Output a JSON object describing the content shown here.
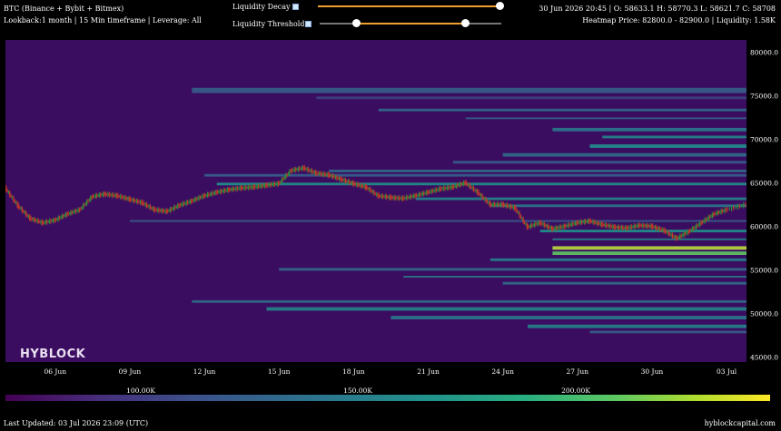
{
  "header": {
    "title": "BTC (Binance + Bybit + Bitmex)",
    "subtitle": "Lookback:1 month | 15 Min timeframe | Leverage: All",
    "ohlc": "30 Jun 2026 20:45 | O: 58633.1 H: 58770.3 L: 58621.7 C: 58708",
    "heatmap_info": "Heatmap Price: 82800.0 - 82900.0 | Liquidity: 1.58K"
  },
  "controls": {
    "decay_label": "Liquidity Decay",
    "threshold_label": "Liquidity Threshold",
    "decay_value": 1.0,
    "threshold_range": [
      0.2,
      0.8
    ]
  },
  "colors": {
    "track": "#f0a030",
    "background": "#3b0d61",
    "candle_up": "#2e8b3a",
    "candle_down": "#c0392b"
  },
  "watermark": "HYBLOCK",
  "colorbar": {
    "ticks": [
      "100.00K",
      "150.00K",
      "200.00K"
    ]
  },
  "footer": {
    "updated": "Last Updated: 03 Jul 2026 23:09 (UTC)",
    "site": "hyblockcapital.com"
  },
  "chart_data": {
    "type": "heatmap",
    "y_ticks": [
      "80000.0",
      "75000.0",
      "70000.0",
      "65000.0",
      "60000.0",
      "55000.0",
      "50000.0",
      "45000.0"
    ],
    "y_tick_values": [
      80000,
      75000,
      70000,
      65000,
      60000,
      55000,
      50000,
      45000
    ],
    "ylim": [
      44500,
      81500
    ],
    "x_ticks": [
      "06 Jun",
      "09 Jun",
      "12 Jun",
      "15 Jun",
      "18 Jun",
      "21 Jun",
      "24 Jun",
      "27 Jun",
      "30 Jun",
      "03 Jul"
    ],
    "x_tick_days": [
      6,
      9,
      12,
      15,
      18,
      21,
      24,
      27,
      30,
      33
    ],
    "xlim_days": [
      4.0,
      33.8
    ],
    "price_series": {
      "day": [
        4.0,
        4.5,
        5.0,
        5.5,
        6.0,
        6.5,
        7.0,
        7.5,
        8.0,
        8.5,
        9.0,
        9.5,
        10.0,
        10.5,
        11.0,
        11.5,
        12.0,
        12.5,
        13.0,
        13.5,
        14.0,
        14.5,
        15.0,
        15.5,
        16.0,
        16.5,
        17.0,
        17.5,
        18.0,
        18.5,
        19.0,
        19.5,
        20.0,
        20.5,
        21.0,
        21.5,
        22.0,
        22.5,
        23.0,
        23.5,
        24.0,
        24.5,
        25.0,
        25.5,
        26.0,
        26.5,
        27.0,
        27.5,
        28.0,
        28.5,
        29.0,
        29.5,
        30.0,
        30.5,
        31.0,
        31.5,
        32.0,
        32.5,
        33.0,
        33.8
      ],
      "close": [
        64500,
        62500,
        61000,
        60500,
        60800,
        61500,
        62000,
        63500,
        63800,
        63600,
        63200,
        62800,
        62000,
        61800,
        62500,
        63000,
        63600,
        64000,
        64300,
        64500,
        64600,
        64800,
        65000,
        66500,
        66800,
        66200,
        66000,
        65500,
        65000,
        64600,
        63600,
        63400,
        63300,
        63600,
        64000,
        64400,
        64600,
        65100,
        64000,
        62600,
        62600,
        62200,
        60000,
        60500,
        59800,
        60100,
        60500,
        60700,
        60300,
        60000,
        59900,
        60200,
        60100,
        59600,
        58700,
        59500,
        60500,
        61500,
        62000,
        62600
      ]
    },
    "bands": [
      {
        "from": 75400,
        "to": 76000,
        "start_day": 11.5,
        "intensity": 0.3
      },
      {
        "from": 74700,
        "to": 75000,
        "start_day": 16.5,
        "intensity": 0.2
      },
      {
        "from": 73300,
        "to": 73600,
        "start_day": 19.0,
        "intensity": 0.35
      },
      {
        "from": 72400,
        "to": 72600,
        "start_day": 22.5,
        "intensity": 0.3
      },
      {
        "from": 71000,
        "to": 71400,
        "start_day": 26.0,
        "intensity": 0.4
      },
      {
        "from": 70200,
        "to": 70500,
        "start_day": 28.0,
        "intensity": 0.45
      },
      {
        "from": 69100,
        "to": 69500,
        "start_day": 27.5,
        "intensity": 0.5
      },
      {
        "from": 68100,
        "to": 68500,
        "start_day": 24.0,
        "intensity": 0.35
      },
      {
        "from": 67300,
        "to": 67600,
        "start_day": 22.0,
        "intensity": 0.3
      },
      {
        "from": 66300,
        "to": 66600,
        "start_day": 17.0,
        "intensity": 0.35
      },
      {
        "from": 65800,
        "to": 66100,
        "start_day": 12.0,
        "intensity": 0.3
      },
      {
        "from": 64800,
        "to": 65100,
        "start_day": 12.5,
        "intensity": 0.5
      },
      {
        "from": 63100,
        "to": 63400,
        "start_day": 20.5,
        "intensity": 0.45
      },
      {
        "from": 62300,
        "to": 62600,
        "start_day": 23.5,
        "intensity": 0.4
      },
      {
        "from": 60600,
        "to": 60800,
        "start_day": 9.0,
        "intensity": 0.3
      },
      {
        "from": 59400,
        "to": 59700,
        "start_day": 25.5,
        "intensity": 0.5
      },
      {
        "from": 58500,
        "to": 58700,
        "start_day": 26.0,
        "intensity": 0.45
      },
      {
        "from": 57400,
        "to": 57800,
        "start_day": 26.0,
        "intensity": 0.9
      },
      {
        "from": 56800,
        "to": 57200,
        "start_day": 26.0,
        "intensity": 0.75
      },
      {
        "from": 56100,
        "to": 56400,
        "start_day": 23.5,
        "intensity": 0.45
      },
      {
        "from": 55000,
        "to": 55300,
        "start_day": 15.0,
        "intensity": 0.35
      },
      {
        "from": 54200,
        "to": 54400,
        "start_day": 20.0,
        "intensity": 0.4
      },
      {
        "from": 53400,
        "to": 53700,
        "start_day": 24.0,
        "intensity": 0.35
      },
      {
        "from": 51300,
        "to": 51600,
        "start_day": 11.5,
        "intensity": 0.35
      },
      {
        "from": 50400,
        "to": 50800,
        "start_day": 14.5,
        "intensity": 0.45
      },
      {
        "from": 49400,
        "to": 49800,
        "start_day": 19.5,
        "intensity": 0.4
      },
      {
        "from": 48400,
        "to": 48800,
        "start_day": 25.0,
        "intensity": 0.45
      },
      {
        "from": 47800,
        "to": 48100,
        "start_day": 27.5,
        "intensity": 0.3
      }
    ]
  }
}
